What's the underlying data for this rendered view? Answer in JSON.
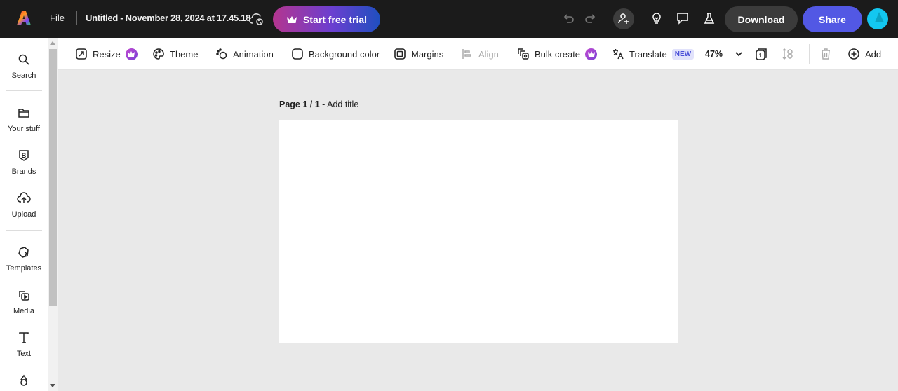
{
  "topbar": {
    "file_label": "File",
    "document_title": "Untitled - November 28, 2024 at 17.45.18",
    "trial_label": "Start free trial",
    "download_label": "Download",
    "share_label": "Share",
    "icons": [
      "adobe-express-logo",
      "cloud-sync-icon",
      "crown-icon",
      "undo-icon",
      "redo-icon",
      "invite-user-icon",
      "lightbulb-icon",
      "comment-icon",
      "flask-icon",
      "avatar"
    ]
  },
  "rail": {
    "items": [
      {
        "label": "Search",
        "icon": "search-icon"
      },
      {
        "label": "Your stuff",
        "icon": "folder-icon"
      },
      {
        "label": "Brands",
        "icon": "brand-icon"
      },
      {
        "label": "Upload",
        "icon": "upload-icon"
      },
      {
        "label": "Templates",
        "icon": "templates-icon"
      },
      {
        "label": "Media",
        "icon": "media-icon"
      },
      {
        "label": "Text",
        "icon": "text-icon"
      },
      {
        "label": "",
        "icon": "elements-icon"
      }
    ]
  },
  "toolbar": {
    "resize": "Resize",
    "theme": "Theme",
    "animation": "Animation",
    "background_color": "Background color",
    "margins": "Margins",
    "align": "Align",
    "bulk_create": "Bulk create",
    "translate": "Translate",
    "new_badge": "NEW",
    "zoom_level": "47%",
    "page_count": "1",
    "add": "Add"
  },
  "canvas": {
    "page_label": "Page 1 / 1",
    "separator": " - ",
    "add_title": "Add title"
  },
  "colors": {
    "topbar_bg": "#1b1b1b",
    "share_btn": "#5258e4",
    "download_btn": "#3b3b3b",
    "canvas_bg": "#e9e9e9",
    "avatar": "#13c7f0"
  }
}
